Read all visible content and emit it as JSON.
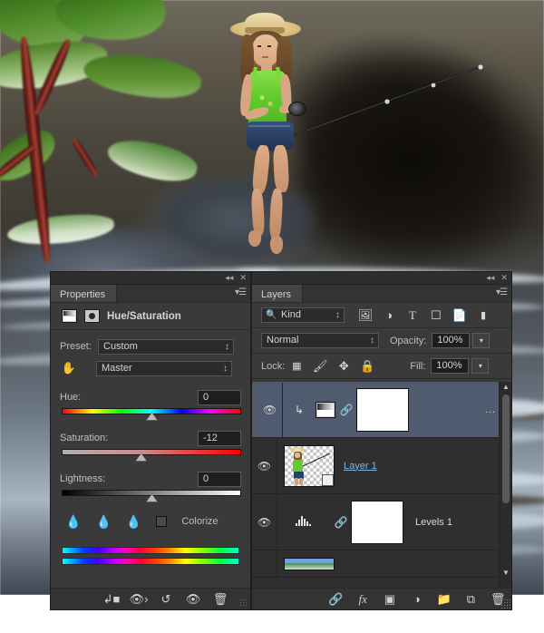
{
  "app": "Adobe Photoshop",
  "properties_panel": {
    "tab_label": "Properties",
    "adjustment_title": "Hue/Saturation",
    "preset_label": "Preset:",
    "preset_value": "Custom",
    "channel_value": "Master",
    "sliders": [
      {
        "label": "Hue:",
        "value": "0",
        "position_pct": 50
      },
      {
        "label": "Saturation:",
        "value": "-12",
        "position_pct": 44
      },
      {
        "label": "Lightness:",
        "value": "0",
        "position_pct": 50
      }
    ],
    "colorize_label": "Colorize",
    "colorize_checked": false,
    "eyedroppers": [
      "eyedropper-icon",
      "eyedropper-plus-icon",
      "eyedropper-minus-icon"
    ],
    "footer_icons": [
      "clip-to-layer-icon",
      "toggle-preview-icon",
      "reset-icon",
      "eye-icon",
      "trash-icon"
    ],
    "header_buttons": [
      "collapse-icon",
      "close-icon"
    ],
    "menu_icon": "panel-menu-icon"
  },
  "layers_panel": {
    "tab_label": "Layers",
    "filter_label": "Kind",
    "filter_icons": [
      "pixel-layer-icon",
      "adjustment-layer-icon",
      "type-layer-icon",
      "shape-layer-icon",
      "smart-object-icon",
      "gradient-filter-icon"
    ],
    "blend_mode": "Normal",
    "opacity_label": "Opacity:",
    "opacity_value": "100%",
    "lock_label": "Lock:",
    "lock_icons": [
      "lock-transparency-icon",
      "lock-image-icon",
      "lock-position-icon",
      "lock-all-icon"
    ],
    "fill_label": "Fill:",
    "fill_value": "100%",
    "rows": [
      {
        "name": "",
        "selected": true,
        "visible": true,
        "type": "adjustment",
        "icon": "hue-saturation-icon",
        "clipped": true,
        "linked": true,
        "has_mask": true,
        "overflow": "..."
      },
      {
        "name": "Layer 1",
        "selected": false,
        "visible": true,
        "type": "pixel",
        "editing": true,
        "has_thumbnail": true
      },
      {
        "name": "Levels 1",
        "selected": false,
        "visible": true,
        "type": "adjustment",
        "icon": "levels-icon",
        "linked": true,
        "has_mask": true
      },
      {
        "name": "",
        "selected": false,
        "visible": false,
        "type": "pixel",
        "partial": true
      }
    ],
    "footer_icons": [
      "link-layers-icon",
      "layer-style-fx-icon",
      "add-mask-icon",
      "new-adjustment-layer-icon",
      "new-group-icon",
      "new-layer-icon",
      "delete-layer-icon"
    ],
    "fx_label": "fx",
    "header_buttons": [
      "collapse-icon",
      "close-icon"
    ],
    "menu_icon": "panel-menu-icon"
  },
  "canvas": {
    "description": "Girl in straw hat fishing, sitting on rock beside stream",
    "foreground_plant": "red-stemmed green leafy plant"
  },
  "colors": {
    "panel_bg": "#3a3a3a",
    "panel_dark": "#2f2f2f",
    "selected_row": "#515b70",
    "text": "#d6d6d6",
    "link_text": "#7fb4e8"
  }
}
